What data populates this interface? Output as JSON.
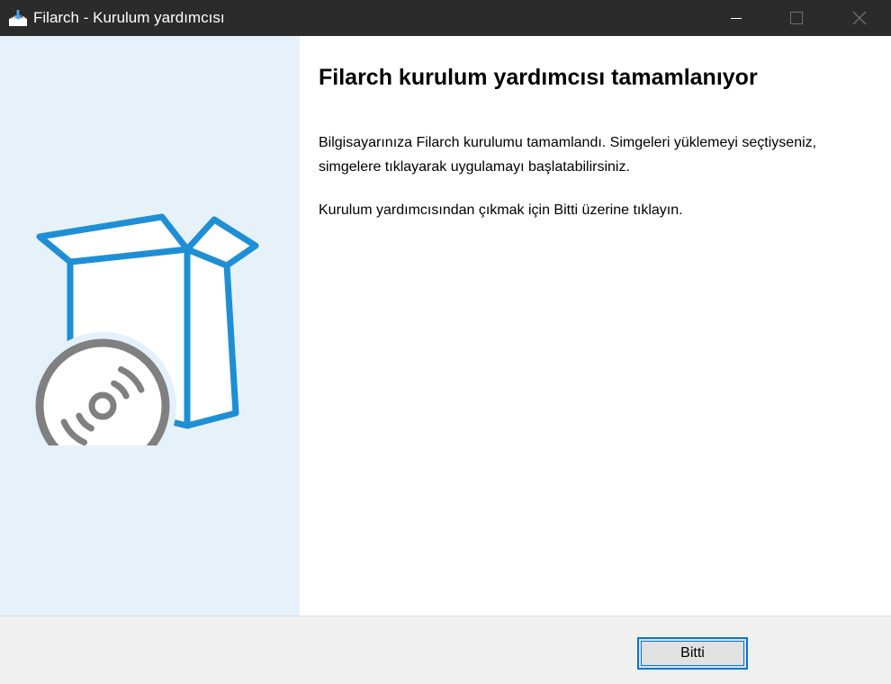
{
  "window": {
    "title": "Filarch - Kurulum yardımcısı",
    "app_icon": "installer-icon",
    "controls": {
      "minimize_icon": "minimize-icon",
      "maximize_icon": "maximize-icon",
      "close_icon": "close-icon"
    }
  },
  "banner": {
    "illustration": "software-box-disc-icon",
    "background_color": "#e6f1fa",
    "accent_color": "#1e8fd5",
    "disc_color": "#808080"
  },
  "main": {
    "heading": "Filarch kurulum yardımcısı tamamlanıyor",
    "paragraph_1": "Bilgisayarınıza Filarch kurulumu tamamlandı. Simgeleri yüklemeyi seçtiyseniz, simgelere tıklayarak uygulamayı başlatabilirsiniz.",
    "paragraph_2": "Kurulum yardımcısından çıkmak için Bitti üzerine tıklayın."
  },
  "footer": {
    "finish_label": "Bitti",
    "button_focus_color": "#0078d7"
  }
}
